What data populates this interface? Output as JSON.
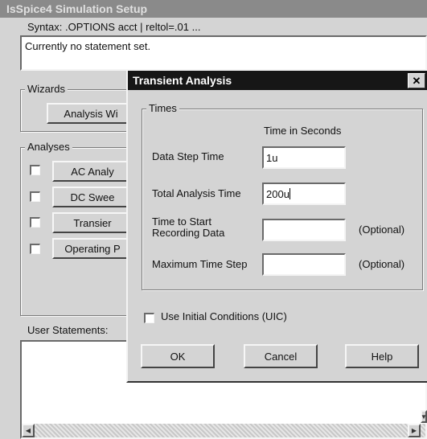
{
  "main_window": {
    "title": "IsSpice4 Simulation Setup",
    "syntax": "Syntax:  .OPTIONS acct | reltol=.01 ...",
    "statement_text": "Currently no statement set.",
    "wizards_label": "Wizards",
    "analysis_wizard_button": "Analysis Wi",
    "analyses_label": "Analyses",
    "analyses": [
      {
        "label": "AC Analy",
        "checked": false
      },
      {
        "label": "DC Swee",
        "checked": false
      },
      {
        "label": "Transier",
        "checked": false
      },
      {
        "label": "Operating P",
        "checked": false
      }
    ],
    "user_statements_label": "User Statements:"
  },
  "dialog": {
    "title": "Transient Analysis",
    "close_glyph": "✕",
    "times_label": "Times",
    "column_header": "Time in Seconds",
    "fields": {
      "data_step": {
        "label": "Data Step Time",
        "value": "1u",
        "optional": ""
      },
      "total_time": {
        "label": "Total Analysis Time",
        "value": "200u",
        "optional": ""
      },
      "start_recording": {
        "label_line1": "Time to Start",
        "label_line2": "Recording Data",
        "value": "",
        "optional": "(Optional)"
      },
      "max_step": {
        "label": "Maximum Time Step",
        "value": "",
        "optional": "(Optional)"
      }
    },
    "uic_label": "Use Initial Conditions (UIC)",
    "uic_checked": false,
    "buttons": {
      "ok": "OK",
      "cancel": "Cancel",
      "help": "Help"
    }
  },
  "icons": {
    "scroll_left": "left-arrow-icon",
    "scroll_right": "right-arrow-icon",
    "scroll_down": "down-arrow-icon"
  }
}
